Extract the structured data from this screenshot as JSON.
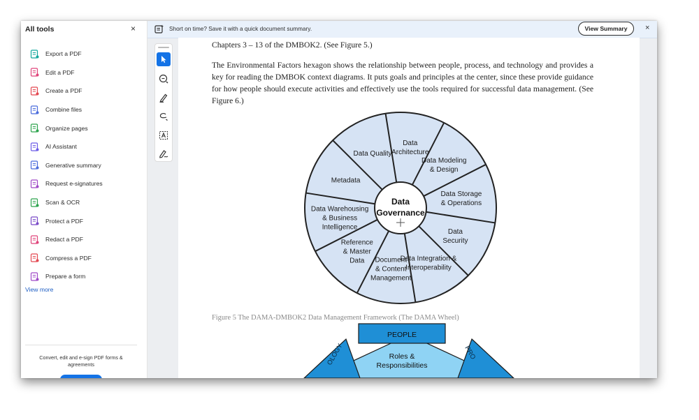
{
  "tools_panel": {
    "title": "All tools",
    "close": "×",
    "items": [
      {
        "label": "Export a PDF",
        "icon": "export-pdf-icon",
        "color": "#13a89e"
      },
      {
        "label": "Edit a PDF",
        "icon": "edit-pdf-icon",
        "color": "#e0457b"
      },
      {
        "label": "Create a PDF",
        "icon": "create-pdf-icon",
        "color": "#e34850"
      },
      {
        "label": "Combine files",
        "icon": "combine-files-icon",
        "color": "#4b6cdc"
      },
      {
        "label": "Organize pages",
        "icon": "organize-pages-icon",
        "color": "#2da44e"
      },
      {
        "label": "AI Assistant",
        "icon": "ai-assistant-icon",
        "color": "#6c5ce7"
      },
      {
        "label": "Generative summary",
        "icon": "generative-summary-icon",
        "color": "#4b6cdc"
      },
      {
        "label": "Request e-signatures",
        "icon": "e-signature-icon",
        "color": "#a04bc8"
      },
      {
        "label": "Scan & OCR",
        "icon": "scan-ocr-icon",
        "color": "#2da44e"
      },
      {
        "label": "Protect a PDF",
        "icon": "protect-pdf-icon",
        "color": "#7a4bc8"
      },
      {
        "label": "Redact a PDF",
        "icon": "redact-pdf-icon",
        "color": "#e0457b"
      },
      {
        "label": "Compress a PDF",
        "icon": "compress-pdf-icon",
        "color": "#e34850"
      },
      {
        "label": "Prepare a form",
        "icon": "prepare-form-icon",
        "color": "#a04bc8"
      }
    ],
    "view_more": "View more",
    "promo_text": "Convert, edit and e-sign PDF forms & agreements"
  },
  "banner": {
    "text": "Short on time? Save it with a quick document summary.",
    "button": "View Summary",
    "close": "×"
  },
  "toolbar": {
    "tools": [
      "select-cursor-icon",
      "add-comment-icon",
      "highlight-pen-icon",
      "draw-freehand-icon",
      "text-box-icon",
      "sign-icon"
    ]
  },
  "document": {
    "line_top": "Chapters 3 – 13 of the DMBOK2. (See Figure 5.)",
    "paragraph": "The Environmental Factors hexagon shows the relationship between people, process, and technology and provides a key for reading the DMBOK context diagrams. It puts goals and principles at the center, since these provide guidance for how people should execute activities and effectively use the tools required for successful data management. (See Figure 6.)",
    "wheel": {
      "center": [
        "Data",
        "Governance"
      ],
      "segments": [
        [
          "Data",
          "Architecture"
        ],
        [
          "Data Modeling",
          "& Design"
        ],
        [
          "Data Storage",
          "& Operations"
        ],
        [
          "Data",
          "Security"
        ],
        [
          "Data Integration &",
          "Interoperability"
        ],
        [
          "Document",
          "& Content",
          "Management"
        ],
        [
          "Reference",
          "& Master",
          "Data"
        ],
        [
          "Data Warehousing",
          "& Business",
          "Intelligence"
        ],
        [
          "Metadata"
        ],
        [
          "Data Quality"
        ]
      ],
      "fill": "#d6e3f4"
    },
    "caption": "Figure 5 The DAMA-DMBOK2 Data Management Framework (The DAMA Wheel)",
    "hexagon": {
      "top_label": "PEOPLE",
      "inner_label": [
        "Roles &",
        "Responsibilities"
      ],
      "left_label": "OLOGY",
      "right_label": "PRO"
    }
  }
}
